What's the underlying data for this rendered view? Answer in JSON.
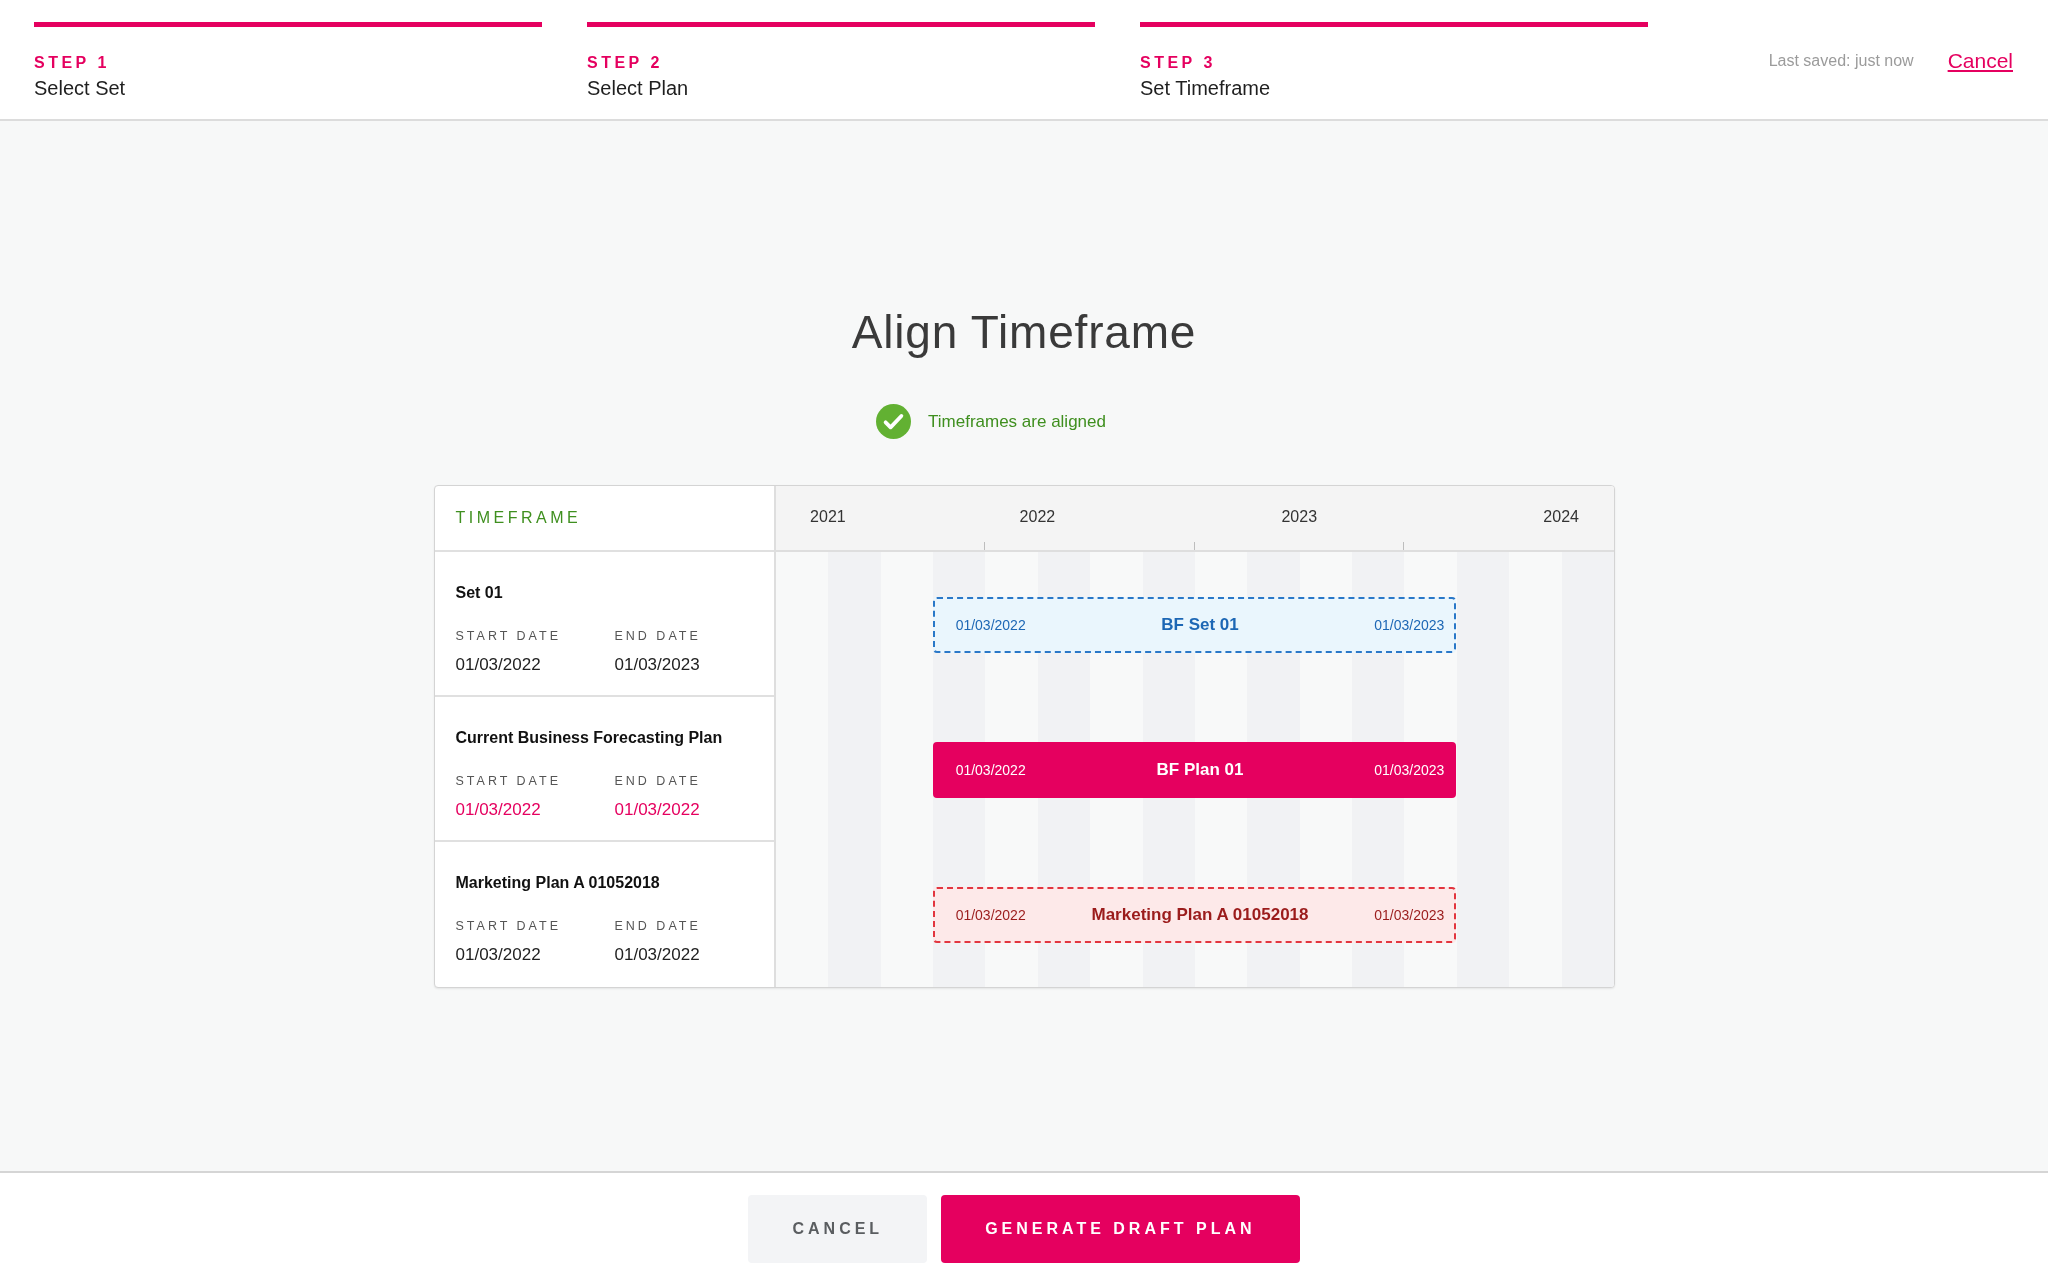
{
  "steps": [
    {
      "label": "STEP 1",
      "name": "Select Set",
      "completed": true
    },
    {
      "label": "STEP 2",
      "name": "Select Plan",
      "completed": true
    },
    {
      "label": "STEP 3",
      "name": "Set Timeframe",
      "completed": true
    }
  ],
  "header": {
    "last_saved": "Last saved: just now",
    "cancel_link": "Cancel"
  },
  "title": "Align Timeframe",
  "status": {
    "kind": "success",
    "text": "Timeframes are aligned"
  },
  "timeframe": {
    "heading": "TIMEFRAME",
    "years": [
      "2021",
      "2022",
      "2023",
      "2024"
    ],
    "rows": [
      {
        "name": "Set 01",
        "start_label": "START DATE",
        "start_date": "01/03/2022",
        "end_label": "END DATE",
        "end_date": "01/03/2023",
        "highlighted": false,
        "bar": {
          "kind": "reference",
          "start": "01/03/2022",
          "label": "BF Set 01",
          "end": "01/03/2023"
        }
      },
      {
        "name": "Current Business Forecasting Plan",
        "start_label": "START DATE",
        "start_date": "01/03/2022",
        "end_label": "END DATE",
        "end_date": "01/03/2022",
        "highlighted": true,
        "bar": {
          "kind": "primary",
          "start": "01/03/2022",
          "label": "BF Plan 01",
          "end": "01/03/2023"
        }
      },
      {
        "name": "Marketing Plan A 01052018",
        "start_label": "START DATE",
        "start_date": "01/03/2022",
        "end_label": "END DATE",
        "end_date": "01/03/2022",
        "highlighted": false,
        "bar": {
          "kind": "warning",
          "start": "01/03/2022",
          "label": "Marketing Plan A 01052018",
          "end": "01/03/2023"
        }
      }
    ]
  },
  "buttons": [
    {
      "kind": "secondary",
      "label": "CANCEL"
    },
    {
      "kind": "primary",
      "label": "GENERATE DRAFT PLAN"
    }
  ]
}
